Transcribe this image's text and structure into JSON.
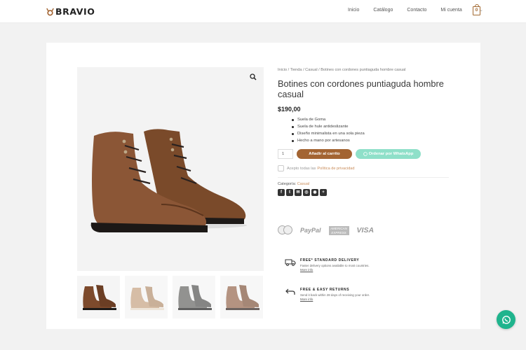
{
  "brand": {
    "name": "BRAVIO",
    "accent": "#a36432",
    "whatsapp_color": "#1fb48d"
  },
  "nav": {
    "items": [
      "Inicio",
      "Catálogo",
      "Contacto",
      "Mi cuenta"
    ],
    "cart_count": "0"
  },
  "product": {
    "breadcrumb": "Inicio / Tienda / Casual / Botines con cordones puntiaguda hombre casual",
    "title": "Botines con cordones puntiaguda hombre casual",
    "price": "$190,00",
    "features": [
      "Suela de Goma",
      "Suela de hule antideslizante",
      "Diseño minimalista en una sola pieza",
      "Hecho a mano por artesanos"
    ],
    "quantity": "1",
    "add_to_cart_label": "Añadir al carrito",
    "whatsapp_label": "Ordenar por WhatsApp",
    "privacy_text": "Acepto todas las",
    "privacy_link": "Política de privacidad",
    "category_label": "Categoría:",
    "category_value": "Casual",
    "share_icons": [
      "facebook-icon",
      "twitter-icon",
      "email-icon",
      "whatsapp-icon",
      "messenger-icon",
      "plus-icon"
    ]
  },
  "payments": {
    "paypal": "PayPal",
    "amex": "AMERICAN EXPRESS",
    "visa": "VISA"
  },
  "benefits": [
    {
      "title": "FREE* STANDARD DELIVERY",
      "desc": "Faster delivery options available to most countries.",
      "more": "More info"
    },
    {
      "title": "FREE & EASY RETURNS",
      "desc": "Send it back within 28 days of receiving your order.",
      "more": "More info"
    }
  ]
}
